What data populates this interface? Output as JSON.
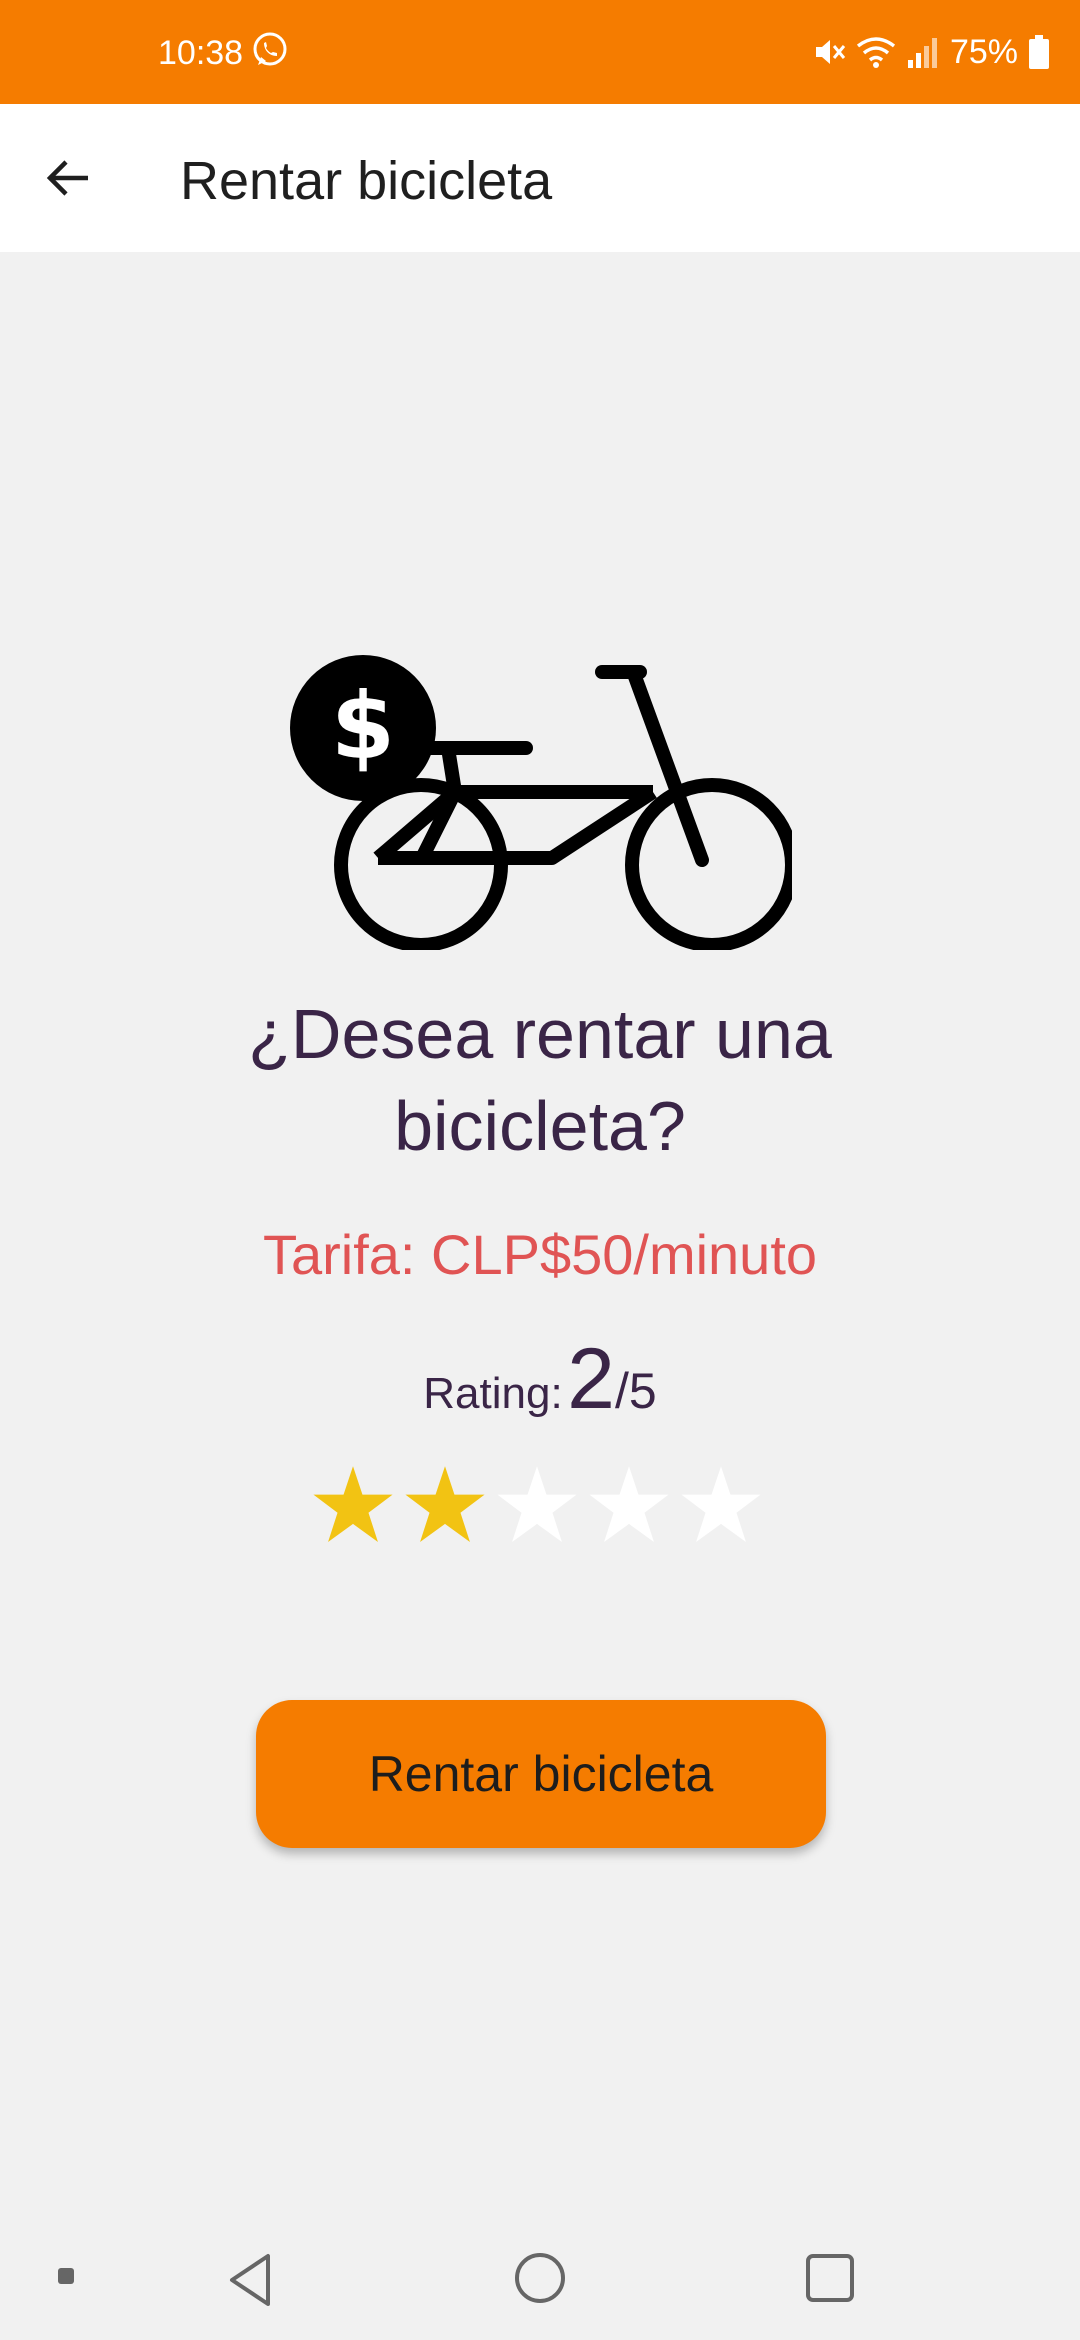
{
  "status_bar": {
    "time": "10:38",
    "battery_percent": "75%",
    "icons": [
      "whatsapp-icon",
      "mute-icon",
      "wifi-icon",
      "signal-icon",
      "battery-icon"
    ]
  },
  "app_bar": {
    "title": "Rentar bicicleta",
    "back_icon": "arrow-left-icon"
  },
  "content": {
    "illustration_icon": "bike-dollar-icon",
    "question_line1": "¿Desea rentar una",
    "question_line2": "bicicleta?",
    "tariff": "Tarifa: CLP$50/minuto",
    "rating_label": "Rating:",
    "rating_value": "2",
    "rating_max": "/5",
    "stars": {
      "filled": 2,
      "total": 5,
      "filled_color": "#f2c313",
      "empty_color": "#ffffff"
    },
    "rent_button_label": "Rentar bicicleta"
  },
  "nav_bar": {
    "icons": [
      "nav-dot-icon",
      "nav-back-icon",
      "nav-home-icon",
      "nav-recents-icon"
    ]
  },
  "colors": {
    "accent": "#f57c00",
    "background": "#f1f1f1",
    "question_text": "#3a2547",
    "tariff_text": "#e05454"
  }
}
